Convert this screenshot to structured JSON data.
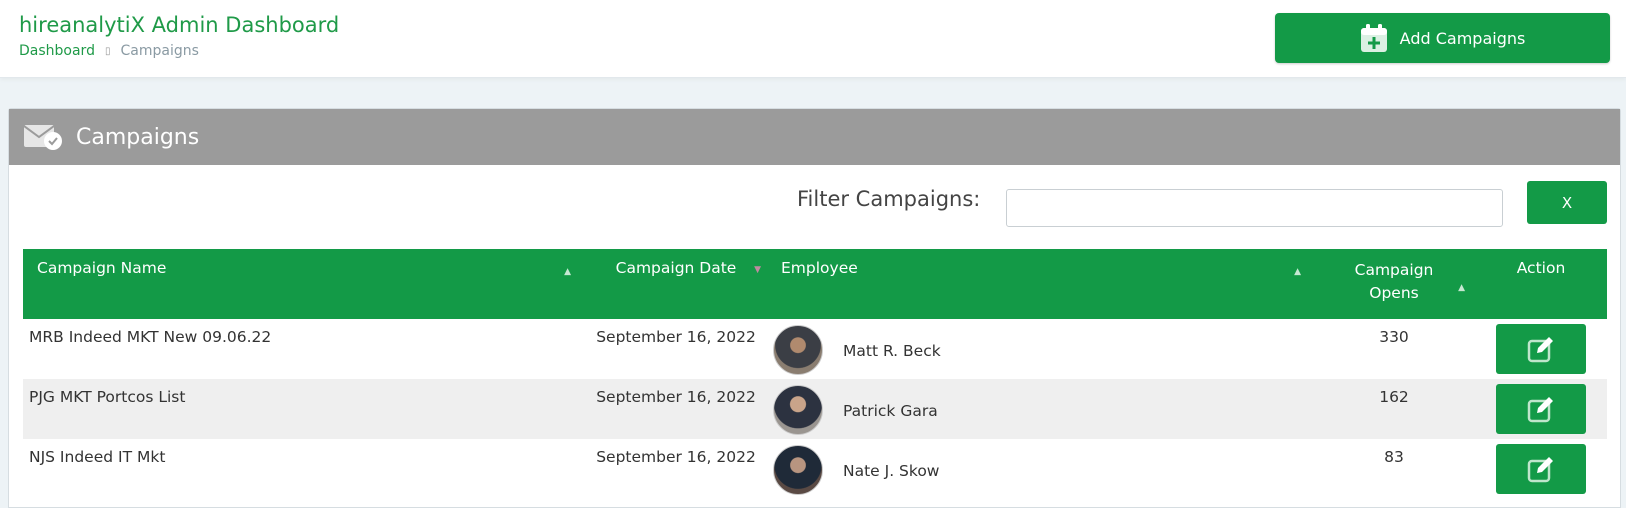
{
  "header": {
    "app_title": "hireanalytiX Admin Dashboard",
    "breadcrumb": {
      "home": "Dashboard",
      "separator": "▯",
      "current": "Campaigns"
    },
    "add_button_label": "Add Campaigns",
    "add_button_icon": "calendar-plus-icon"
  },
  "card": {
    "title": "Campaigns",
    "title_icon": "envelope-check-icon"
  },
  "filter": {
    "label": "Filter Campaigns:",
    "value": "",
    "placeholder": "",
    "clear_label": "X"
  },
  "table": {
    "headers": {
      "name": "Campaign Name",
      "date": "Campaign Date",
      "employee": "Employee",
      "opens_line1": "Campaign",
      "opens_line2": "Opens",
      "action": "Action"
    },
    "rows": [
      {
        "name": "MRB Indeed MKT New 09.06.22",
        "date": "September 16, 2022",
        "employee": "Matt R. Beck",
        "opens": "330"
      },
      {
        "name": "PJG MKT Portcos List",
        "date": "September 16, 2022",
        "employee": "Patrick Gara",
        "opens": "162"
      },
      {
        "name": "NJS Indeed IT Mkt",
        "date": "September 16, 2022",
        "employee": "Nate J. Skow",
        "opens": "83"
      }
    ]
  },
  "colors": {
    "brand_green": "#139a47",
    "title_green": "#1f9a48",
    "card_header_gray": "#9b9b9b"
  }
}
